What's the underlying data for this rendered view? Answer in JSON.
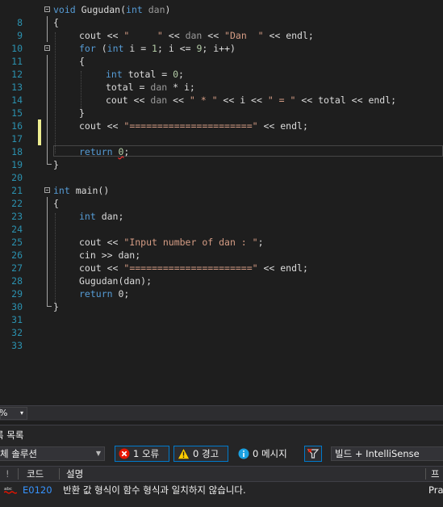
{
  "editor": {
    "lines": [
      {
        "n": "8"
      },
      {
        "n": "9"
      },
      {
        "n": "10"
      },
      {
        "n": "11"
      },
      {
        "n": "12"
      },
      {
        "n": "13"
      },
      {
        "n": "14"
      },
      {
        "n": "15"
      },
      {
        "n": "16"
      },
      {
        "n": "17"
      },
      {
        "n": "18"
      },
      {
        "n": "19"
      },
      {
        "n": "20"
      },
      {
        "n": "21"
      },
      {
        "n": "22"
      },
      {
        "n": "23"
      },
      {
        "n": "24"
      },
      {
        "n": "25"
      },
      {
        "n": "26"
      },
      {
        "n": "27"
      },
      {
        "n": "28"
      },
      {
        "n": "29"
      },
      {
        "n": "30"
      },
      {
        "n": "31"
      },
      {
        "n": "32"
      },
      {
        "n": "33"
      }
    ],
    "code": {
      "l8": {
        "kw": "void",
        "name": " Gugudan(",
        "kw2": "int",
        "param": " dan",
        "end": ")"
      },
      "l9": "{",
      "l10": {
        "a": "cout << ",
        "s1": "\"     \"",
        "b": " << ",
        "p": "dan",
        "c": " << ",
        "s2": "\"Dan  \"",
        "d": " << endl;"
      },
      "l11": {
        "kw": "for",
        "a": " (",
        "kw2": "int",
        "b": " i = ",
        "n1": "1",
        "c": "; i <= ",
        "n2": "9",
        "d": "; i++)"
      },
      "l12": "{",
      "l13": {
        "kw": "int",
        "a": " total = ",
        "n": "0",
        "b": ";"
      },
      "l14": {
        "a": "total = ",
        "p": "dan",
        "b": " * i;"
      },
      "l15": {
        "a": "cout << ",
        "p": "dan",
        "b": " << ",
        "s1": "\" * \"",
        "c": " << i << ",
        "s2": "\" = \"",
        "d": " << total << endl;"
      },
      "l16": "}",
      "l17": {
        "a": "cout << ",
        "s": "\"======================\"",
        "b": " << endl;"
      },
      "l19": {
        "kw": "return",
        "sp": " ",
        "n": "0",
        "b": ";"
      },
      "l20": "}",
      "l22": {
        "kw": "int",
        "a": " main()"
      },
      "l23": "{",
      "l24": {
        "kw": "int",
        "a": " dan;"
      },
      "l26": {
        "a": "cout << ",
        "s": "\"Input number of dan : \"",
        "b": ";"
      },
      "l27": "cin >> dan;",
      "l28": {
        "a": "cout << ",
        "s": "\"======================\"",
        "b": " << endl;"
      },
      "l29": "Gugudan(dan);",
      "l30": {
        "kw": "return",
        "a": " 0;"
      },
      "l31": "}"
    }
  },
  "zoom": {
    "value": "%",
    "arrow": "▾"
  },
  "error_list": {
    "title": "록 목록",
    "scope": "체 솔루션",
    "errors_label": "1 오류",
    "warnings_label": "0 경고",
    "messages_label": "0 메시지",
    "build_filter": "빌드 + IntelliSense",
    "columns": {
      "code": "코드",
      "description": "설명",
      "project": "프"
    },
    "rows": [
      {
        "code": "E0120",
        "description": "반환 값 형식이 함수 형식과 일치하지 않습니다.",
        "project": "Pra"
      }
    ]
  },
  "colors": {
    "keyword": "#569cd6",
    "string": "#d69d85",
    "number": "#b5cea8",
    "line_number": "#2b91af",
    "accent": "#007acc"
  }
}
